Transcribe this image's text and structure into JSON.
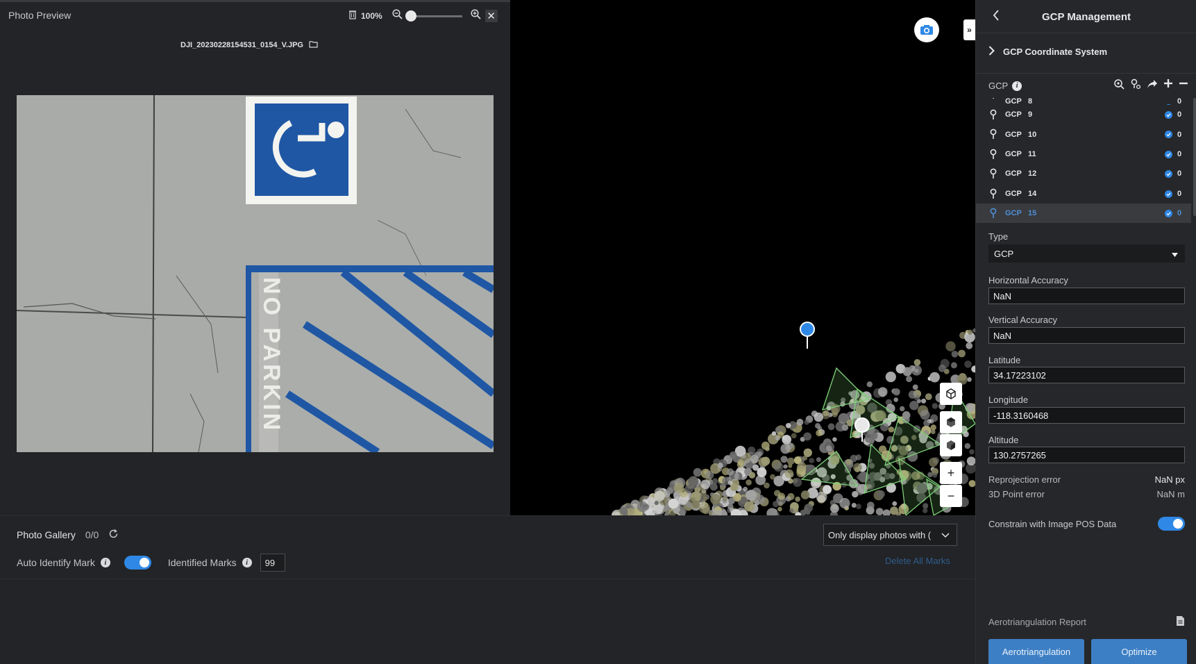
{
  "preview": {
    "title": "Photo Preview",
    "zoom": "100%",
    "zoom_level": 0.0,
    "filename": "DJI_20230228154531_0154_V.JPG"
  },
  "gallery": {
    "title": "Photo Gallery",
    "count": "0/0",
    "auto_identify_label": "Auto Identify Mark",
    "auto_identify_on": true,
    "identified_marks_label": "Identified Marks",
    "identified_marks_value": "99",
    "filter_value": "Only display photos with (",
    "delete_all_label": "Delete All Marks"
  },
  "panel": {
    "title": "GCP Management",
    "coord_system_label": "GCP Coordinate System",
    "gcp_label": "GCP",
    "gcp_rows": [
      {
        "name": "GCP",
        "num": "8",
        "count": "0",
        "partial": true
      },
      {
        "name": "GCP",
        "num": "9",
        "count": "0"
      },
      {
        "name": "GCP",
        "num": "10",
        "count": "0"
      },
      {
        "name": "GCP",
        "num": "11",
        "count": "0"
      },
      {
        "name": "GCP",
        "num": "12",
        "count": "0"
      },
      {
        "name": "GCP",
        "num": "14",
        "count": "0"
      },
      {
        "name": "GCP",
        "num": "15",
        "count": "0",
        "selected": true
      }
    ],
    "type_label": "Type",
    "type_value": "GCP",
    "horizontal_accuracy_label": "Horizontal Accuracy",
    "horizontal_accuracy_value": "NaN",
    "vertical_accuracy_label": "Vertical Accuracy",
    "vertical_accuracy_value": "NaN",
    "latitude_label": "Latitude",
    "latitude_value": "34.17223102",
    "longitude_label": "Longitude",
    "longitude_value": "-118.3160468",
    "altitude_label": "Altitude",
    "altitude_value": "130.2757265",
    "reprojection_label": "Reprojection error",
    "reprojection_value": "NaN px",
    "point_error_label": "3D Point error",
    "point_error_value": "NaN m",
    "constrain_label": "Constrain with Image POS Data",
    "constrain_on": true,
    "aero_report_label": "Aerotriangulation Report",
    "aero_button": "Aerotriangulation",
    "optimize_button": "Optimize"
  },
  "colors": {
    "accent": "#2f88e6",
    "button": "#3d7fc4",
    "link": "#2e5d8d"
  },
  "icons": [
    "trash-icon",
    "zoom-out-icon",
    "zoom-in-icon",
    "close-icon",
    "folder-icon",
    "camera-icon",
    "expand-icon",
    "refresh-icon",
    "info-icon",
    "chevron-down-icon",
    "back-icon",
    "chevron-right-icon",
    "pin-icon",
    "check-icon",
    "document-icon"
  ]
}
